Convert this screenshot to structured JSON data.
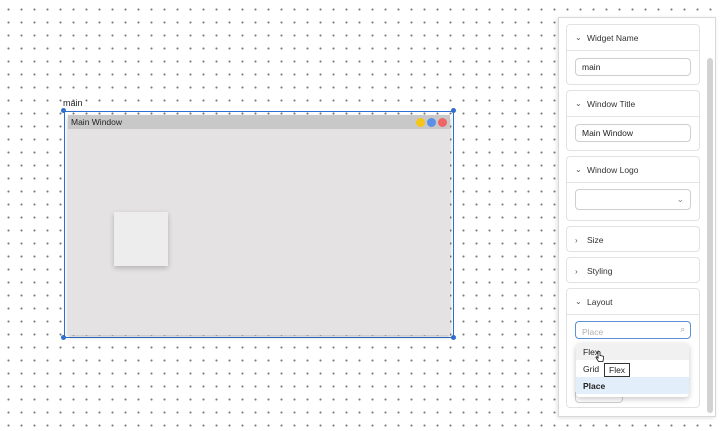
{
  "canvas": {
    "widget_label": "main",
    "window": {
      "title": "Main Window",
      "controls": [
        {
          "name": "minimize",
          "color": "#f5c518"
        },
        {
          "name": "maximize",
          "color": "#5b8fe8"
        },
        {
          "name": "close",
          "color": "#ef6464"
        }
      ]
    },
    "selection_color": "#2f6fcf"
  },
  "panel": {
    "sections": [
      {
        "label": "Widget Name",
        "expanded": true,
        "value": "main"
      },
      {
        "label": "Window Title",
        "expanded": true,
        "value": "Main Window"
      },
      {
        "label": "Window Logo",
        "expanded": true,
        "value": ""
      },
      {
        "label": "Size",
        "expanded": false
      },
      {
        "label": "Styling",
        "expanded": false
      },
      {
        "label": "Layout",
        "expanded": true,
        "placeholder": "Place"
      }
    ],
    "layout_dropdown": {
      "options": [
        "Flex",
        "Grid",
        "Place"
      ],
      "hovered": "Flex",
      "selected": "Place"
    },
    "tooltip": "Flex"
  },
  "icons": {
    "chevron_down": "⌄",
    "chevron_right": "›",
    "search": "🔍"
  }
}
